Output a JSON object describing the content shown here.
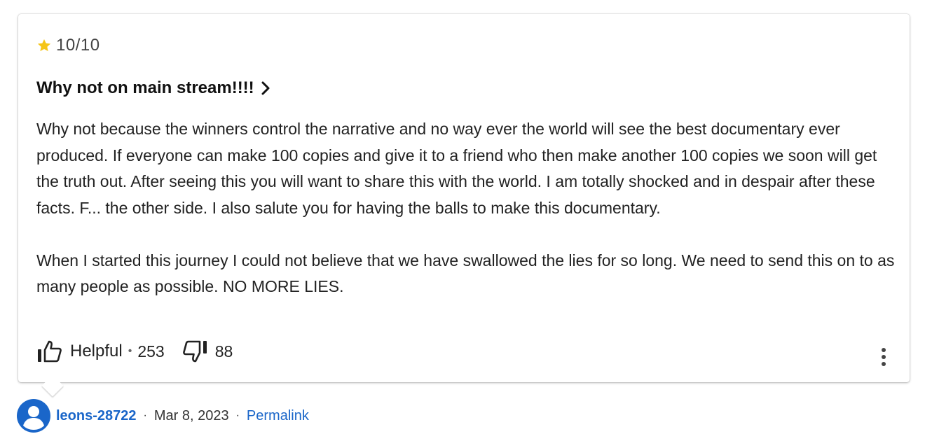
{
  "review": {
    "rating_label": "10/10",
    "rating_value": 10,
    "rating_max": 10,
    "title": "Why not on main stream!!!!",
    "body_paragraphs": [
      "Why not because the winners control the narrative and no way ever the world will see the best documentary ever produced. If everyone can make 100 copies and give it to a friend who then make another 100 copies we soon will get the truth out. After seeing this you will want to share this with the world. I am totally shocked and in despair after these facts. F... the other side. I also salute you for having the balls to make this documentary.",
      "When I started this journey I could not believe that we have swallowed the lies for so long. We need to send this on to as many people as possible. NO MORE LIES."
    ],
    "helpful_label": "Helpful",
    "separator": "•",
    "helpful_count": "253",
    "not_helpful_count": "88"
  },
  "author": {
    "username": "leons-28722",
    "date": "Mar 8, 2023",
    "separator": "·",
    "permalink_label": "Permalink"
  },
  "icons": {
    "star": "star-icon",
    "chevron": "chevron-right-icon",
    "thumb_up": "thumb-up-icon",
    "thumb_down": "thumb-down-icon",
    "more": "more-vertical-icon",
    "avatar": "avatar-icon"
  },
  "colors": {
    "star": "#f5c518",
    "link": "#1a66c9",
    "avatar": "#1a66c9"
  }
}
